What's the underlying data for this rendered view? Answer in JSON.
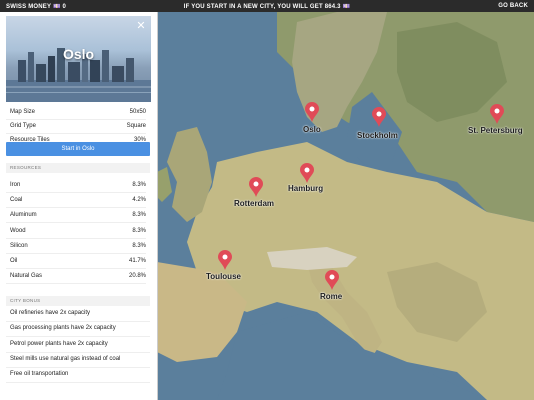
{
  "topbar": {
    "money": "SWISS MONEY 💷 0",
    "message": "IF YOU START IN A NEW CITY, YOU WILL GET 864.3 💷",
    "back": "GO BACK"
  },
  "panel": {
    "city_title": "Oslo",
    "close_glyph": "✕",
    "info": [
      {
        "key": "Map Size",
        "value": "50x50"
      },
      {
        "key": "Grid Type",
        "value": "Square"
      },
      {
        "key": "Resource Tiles",
        "value": "30%"
      }
    ],
    "start_label": "Start in Oslo",
    "resources_header": "RESOURCES",
    "resources": [
      {
        "key": "Iron",
        "value": "8.3%"
      },
      {
        "key": "Coal",
        "value": "4.2%"
      },
      {
        "key": "Aluminum",
        "value": "8.3%"
      },
      {
        "key": "Wood",
        "value": "8.3%"
      },
      {
        "key": "Silicon",
        "value": "8.3%"
      },
      {
        "key": "Oil",
        "value": "41.7%"
      },
      {
        "key": "Natural Gas",
        "value": "20.8%"
      }
    ],
    "bonus_header": "CITY BONUS",
    "bonuses": [
      "Oil refineries have 2x capacity",
      "Gas processing plants have 2x capacity",
      "Petrol power plants have 2x capacity",
      "Steel mills use natural gas instead of coal",
      "Free oil transportation"
    ]
  },
  "cities": [
    {
      "name": "Oslo"
    },
    {
      "name": "Stockholm"
    },
    {
      "name": "St. Petersburg"
    },
    {
      "name": "Hamburg"
    },
    {
      "name": "Rotterdam"
    },
    {
      "name": "Toulouse"
    },
    {
      "name": "Rome"
    }
  ],
  "colors": {
    "pin": "#e04b57",
    "start_button": "#4a90e2",
    "sea": "#5b7f9c",
    "land": "#c9c08f"
  }
}
